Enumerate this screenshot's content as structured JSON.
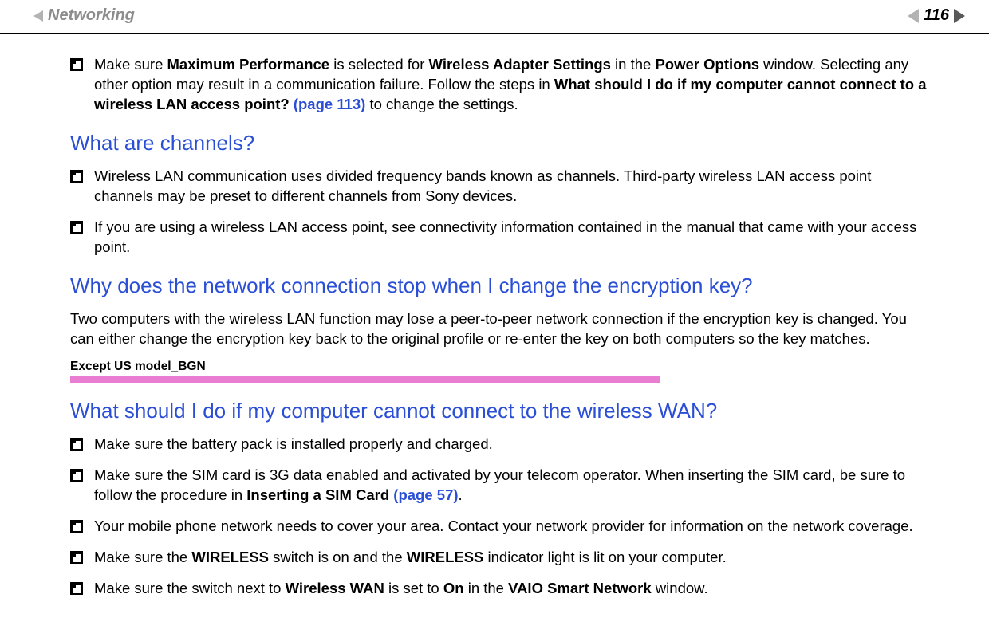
{
  "header": {
    "section": "Networking",
    "page": "116"
  },
  "bullets_top": {
    "b1_pre": "Make sure ",
    "b1_s1": "Maximum Performance",
    "b1_mid1": " is selected for ",
    "b1_s2": "Wireless Adapter Settings",
    "b1_mid2": " in the ",
    "b1_s3": "Power Options",
    "b1_mid3": " window. Selecting any other option may result in a communication failure. Follow the steps in ",
    "b1_s4": "What should I do if my computer cannot connect to a wireless LAN access point?",
    "b1_link": " (page 113)",
    "b1_tail": " to change the settings."
  },
  "h1": "What are channels?",
  "channels": {
    "b1": "Wireless LAN communication uses divided frequency bands known as channels. Third-party wireless LAN access point channels may be preset to different channels from Sony devices.",
    "b2": "If you are using a wireless LAN access point, see connectivity information contained in the manual that came with your access point."
  },
  "h2": "Why does the network connection stop when I change the encryption key?",
  "para_enc": "Two computers with the wireless LAN function may lose a peer-to-peer network connection if the encryption key is changed. You can either change the encryption key back to the original profile or re-enter the key on both computers so the key matches.",
  "except_label": "Except US model_BGN",
  "h3": "What should I do if my computer cannot connect to the wireless WAN?",
  "wan": {
    "b1": "Make sure the battery pack is installed properly and charged.",
    "b2_pre": "Make sure the SIM card is 3G data enabled and activated by your telecom operator. When inserting the SIM card, be sure to follow the procedure in ",
    "b2_s1": "Inserting a SIM Card",
    "b2_link": " (page 57)",
    "b2_tail": ".",
    "b3": "Your mobile phone network needs to cover your area. Contact your network provider for information on the network coverage.",
    "b4_pre": "Make sure the ",
    "b4_s1": "WIRELESS",
    "b4_mid1": " switch is on and the ",
    "b4_s2": "WIRELESS",
    "b4_tail": " indicator light is lit on your computer.",
    "b5_pre": "Make sure the switch next to ",
    "b5_s1": "Wireless WAN",
    "b5_mid1": " is set to ",
    "b5_s2": "On",
    "b5_mid2": " in the ",
    "b5_s3": "VAIO Smart Network",
    "b5_tail": " window."
  }
}
